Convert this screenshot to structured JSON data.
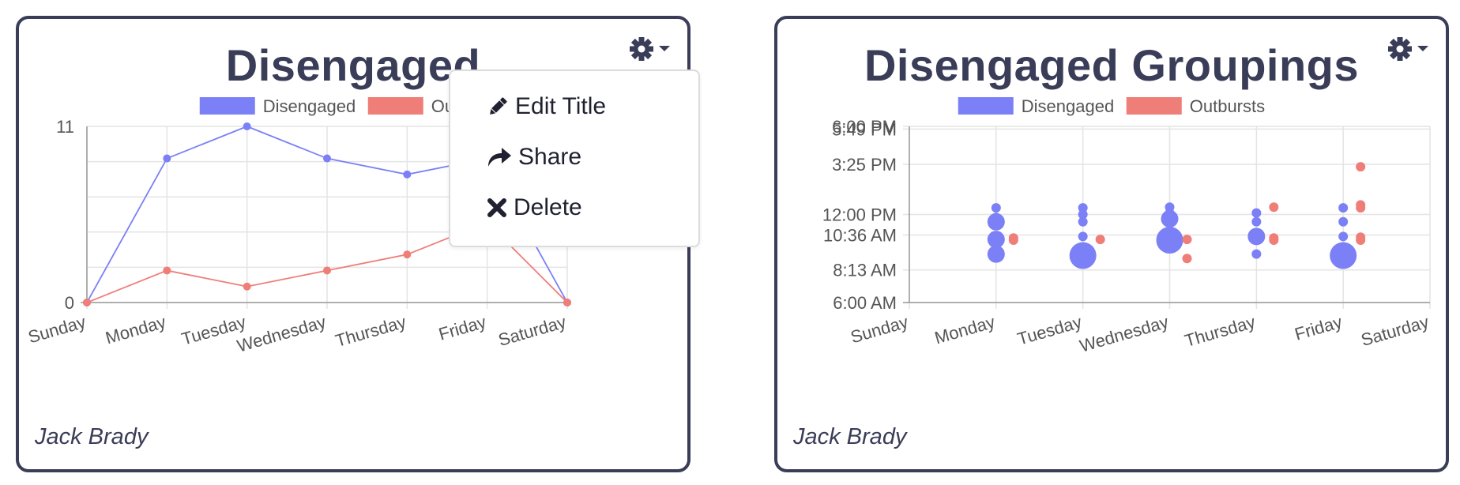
{
  "colors": {
    "blue": "#7b80f6",
    "red": "#ef7d78",
    "border": "#3a3d57",
    "grid": "#e4e4e4"
  },
  "card1": {
    "title": "Disengaged",
    "author": "Jack Brady",
    "gear_icon": "gear-icon",
    "menu": {
      "items": [
        {
          "label": "Edit Title",
          "icon": "pencil-icon"
        },
        {
          "label": "Share",
          "icon": "share-icon"
        },
        {
          "label": "Delete",
          "icon": "close-icon"
        }
      ]
    }
  },
  "card2": {
    "title": "Disengaged Groupings",
    "author": "Jack Brady",
    "gear_icon": "gear-icon"
  },
  "chart_data": [
    {
      "type": "line",
      "categories": [
        "Sunday",
        "Monday",
        "Tuesday",
        "Wednesday",
        "Thursday",
        "Friday",
        "Saturday"
      ],
      "series": [
        {
          "name": "Disengaged",
          "color": "#7b80f6",
          "values": [
            0,
            9,
            11,
            9,
            8,
            9,
            0
          ]
        },
        {
          "name": "Outbursts",
          "color": "#ef7d78",
          "values": [
            0,
            2,
            1,
            2,
            3,
            5,
            0
          ]
        }
      ],
      "ytick_labels": [
        "0",
        "11"
      ],
      "ylim": [
        0,
        11
      ],
      "grid": true,
      "legend": "top"
    },
    {
      "type": "scatter",
      "categories": [
        "Sunday",
        "Monday",
        "Tuesday",
        "Wednesday",
        "Thursday",
        "Friday",
        "Saturday"
      ],
      "ytick_labels": [
        "6:00 AM",
        "8:13 AM",
        "10:36 AM",
        "12:00 PM",
        "3:25 PM",
        "5:49 PM",
        "6:00 PM"
      ],
      "ytick_values": [
        6.0,
        8.22,
        10.6,
        12.0,
        15.42,
        17.82,
        18.0
      ],
      "ylim": [
        6.0,
        18.0
      ],
      "grid": true,
      "legend": "top",
      "series": [
        {
          "name": "Disengaged",
          "color": "#7b80f6",
          "points": [
            {
              "day": 1,
              "time": 12.45,
              "size": 1
            },
            {
              "day": 1,
              "time": 11.8,
              "size": 1
            },
            {
              "day": 1,
              "time": 11.5,
              "size": 2
            },
            {
              "day": 1,
              "time": 10.3,
              "size": 2
            },
            {
              "day": 1,
              "time": 9.3,
              "size": 2
            },
            {
              "day": 2,
              "time": 12.45,
              "size": 1
            },
            {
              "day": 2,
              "time": 12.0,
              "size": 1
            },
            {
              "day": 2,
              "time": 11.5,
              "size": 1
            },
            {
              "day": 2,
              "time": 10.5,
              "size": 1
            },
            {
              "day": 2,
              "time": 9.2,
              "size": 3
            },
            {
              "day": 3,
              "time": 12.5,
              "size": 1
            },
            {
              "day": 3,
              "time": 12.1,
              "size": 1
            },
            {
              "day": 3,
              "time": 11.7,
              "size": 2
            },
            {
              "day": 3,
              "time": 10.25,
              "size": 3
            },
            {
              "day": 4,
              "time": 12.1,
              "size": 1
            },
            {
              "day": 4,
              "time": 11.5,
              "size": 1
            },
            {
              "day": 4,
              "time": 10.5,
              "size": 2
            },
            {
              "day": 4,
              "time": 9.3,
              "size": 1
            },
            {
              "day": 5,
              "time": 12.45,
              "size": 1
            },
            {
              "day": 5,
              "time": 11.5,
              "size": 1
            },
            {
              "day": 5,
              "time": 10.5,
              "size": 1
            },
            {
              "day": 5,
              "time": 9.2,
              "size": 3
            }
          ]
        },
        {
          "name": "Outbursts",
          "color": "#ef7d78",
          "points": [
            {
              "day": 1,
              "time": 10.4,
              "size": 1
            },
            {
              "day": 1,
              "time": 10.25,
              "size": 1
            },
            {
              "day": 2,
              "time": 10.3,
              "size": 1
            },
            {
              "day": 3,
              "time": 10.3,
              "size": 1
            },
            {
              "day": 3,
              "time": 9.0,
              "size": 1
            },
            {
              "day": 4,
              "time": 12.5,
              "size": 1
            },
            {
              "day": 4,
              "time": 10.4,
              "size": 1
            },
            {
              "day": 4,
              "time": 10.25,
              "size": 1
            },
            {
              "day": 5,
              "time": 15.25,
              "size": 1
            },
            {
              "day": 5,
              "time": 12.65,
              "size": 1
            },
            {
              "day": 5,
              "time": 12.45,
              "size": 1
            },
            {
              "day": 5,
              "time": 10.45,
              "size": 1
            },
            {
              "day": 5,
              "time": 10.25,
              "size": 1
            }
          ]
        }
      ]
    }
  ]
}
